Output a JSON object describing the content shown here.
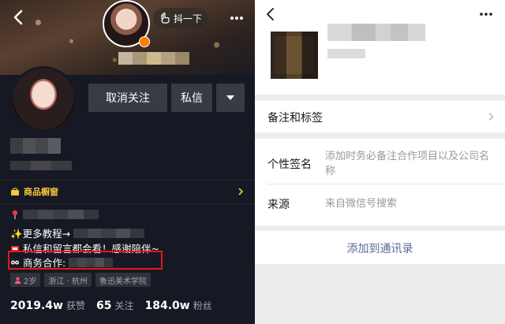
{
  "colors": {
    "dark_bg": "#161823",
    "button_bg": "#393b44",
    "shop_accent": "#f7c33d",
    "highlight_box": "#e11a1a",
    "wechat_link": "#576b95",
    "wechat_bg": "#ededed"
  },
  "left": {
    "shake_label": "抖一下",
    "unfollow_label": "取消关注",
    "message_label": "私信",
    "shop_label": "商品橱窗",
    "bio": {
      "line2": "✨更多教程→",
      "line3": "私信和留言都会看！感谢陪伴~",
      "business_label": "商务合作:"
    },
    "tags": {
      "age": "2岁",
      "location": "浙江 · 杭州",
      "school": "鲁迅美术学院"
    },
    "stats": {
      "likes_value": "2019.4w",
      "likes_label": "获赞",
      "following_value": "65",
      "following_label": "关注",
      "followers_value": "184.0w",
      "followers_label": "粉丝"
    },
    "icons": [
      "back-arrow-icon",
      "hand-shake-icon",
      "more-dots-icon",
      "dropdown-triangle-icon",
      "shop-icon",
      "chevron-right-icon",
      "person-icon"
    ]
  },
  "right": {
    "remark_label": "备注和标签",
    "signature_label": "个性签名",
    "signature_value": "添加时务必备注合作项目以及公司名称",
    "source_label": "来源",
    "source_value": "来自微信号搜索",
    "add_contact_label": "添加到通讯录",
    "icons": [
      "back-arrow-icon",
      "more-dots-icon",
      "chevron-right-icon"
    ]
  }
}
